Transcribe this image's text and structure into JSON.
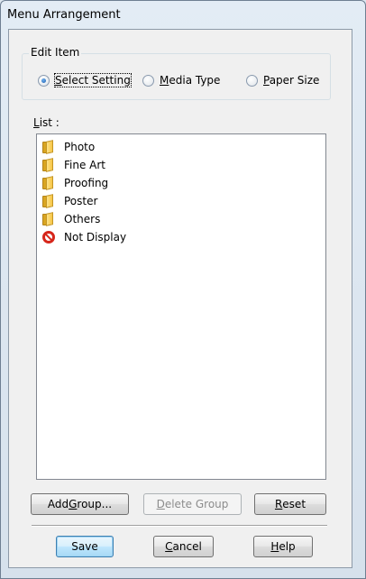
{
  "window": {
    "title": "Menu Arrangement"
  },
  "edit_item": {
    "legend": "Edit Item",
    "options": [
      {
        "label_pre": "",
        "label_ul": "S",
        "label_post": "elect Setting",
        "selected": true
      },
      {
        "label_pre": "",
        "label_ul": "M",
        "label_post": "edia Type",
        "selected": false
      },
      {
        "label_pre": "",
        "label_ul": "P",
        "label_post": "aper Size",
        "selected": false
      }
    ]
  },
  "list": {
    "label_ul": "L",
    "label_post": "ist :",
    "items": [
      {
        "label": "Photo",
        "icon": "folder-icon"
      },
      {
        "label": "Fine Art",
        "icon": "folder-icon"
      },
      {
        "label": "Proofing",
        "icon": "folder-icon"
      },
      {
        "label": "Poster",
        "icon": "folder-icon"
      },
      {
        "label": "Others",
        "icon": "folder-icon"
      },
      {
        "label": "Not Display",
        "icon": "no-entry-icon"
      }
    ]
  },
  "buttons": {
    "add_group": {
      "pre": "Add ",
      "ul": "G",
      "post": "roup..."
    },
    "delete_group": {
      "pre": "",
      "ul": "D",
      "post": "elete Group"
    },
    "reset": {
      "pre": "",
      "ul": "R",
      "post": "eset"
    },
    "save": {
      "label": "Save"
    },
    "cancel": {
      "pre": "",
      "ul": "C",
      "post": "ancel"
    },
    "help": {
      "pre": "",
      "ul": "H",
      "post": "elp"
    }
  }
}
